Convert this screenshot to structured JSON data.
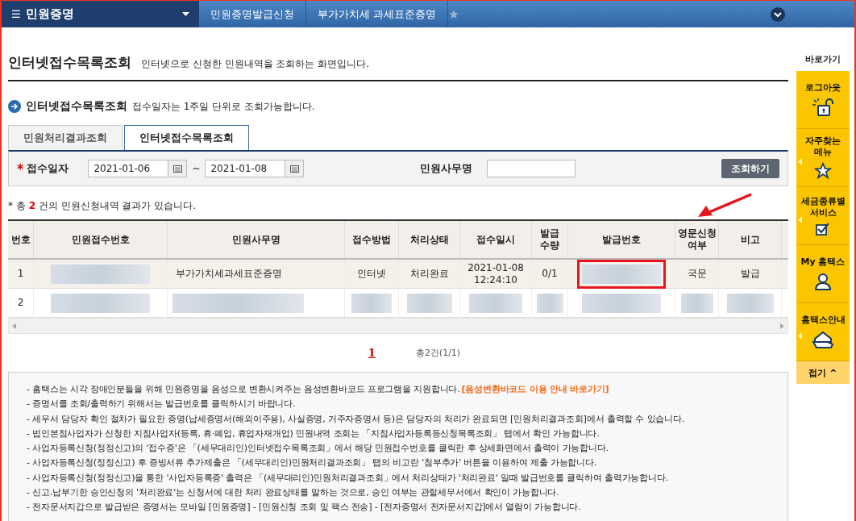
{
  "nav": {
    "menu_icon": "☰",
    "menu_title": "민원증명",
    "crumbs": [
      {
        "label": "민원증명발급신청"
      },
      {
        "label": "부가가치세 과세표준증명"
      }
    ]
  },
  "page": {
    "title": "인터넷접수목록조회",
    "subtitle": "인터넷으로 신청한 민원내역을 조회하는 화면입니다."
  },
  "section": {
    "title": "인터넷접수목록조회",
    "note": "접수일자는 1주일 단위로 조회가능합니다."
  },
  "tabs": [
    {
      "label": "민원처리결과조회",
      "selected": false
    },
    {
      "label": "인터넷접수목록조회",
      "selected": true
    }
  ],
  "search": {
    "required_mark": "*",
    "date_label": "접수일자",
    "date_from": "2021-01-06",
    "tilde": "~",
    "date_to": "2021-01-08",
    "name_label": "민원사무명",
    "button": "조회하기"
  },
  "result": {
    "prefix": "* 총",
    "count": "2",
    "suffix": "건의 민원신청내역 결과가 있습니다."
  },
  "table": {
    "columns": [
      "번호",
      "민원접수번호",
      "민원사무명",
      "접수방법",
      "처리상태",
      "접수일시",
      "발급\n수량",
      "발급번호",
      "영문신청\n여부",
      "비고"
    ],
    "rows": [
      {
        "selected": true,
        "cells": [
          {
            "kind": "text",
            "text": "1",
            "highlighted": false
          },
          {
            "kind": "redacted",
            "highlighted": false
          },
          {
            "kind": "text",
            "text": "부가가치세과세표준증명",
            "highlighted": false
          },
          {
            "kind": "text",
            "text": "인터넷",
            "highlighted": false
          },
          {
            "kind": "text",
            "text": "처리완료",
            "highlighted": false
          },
          {
            "kind": "text",
            "text": "2021-01-08\n12:24:10",
            "highlighted": false
          },
          {
            "kind": "text",
            "text": "0/1",
            "highlighted": false
          },
          {
            "kind": "redacted",
            "highlighted": true
          },
          {
            "kind": "text",
            "text": "국문",
            "highlighted": false
          },
          {
            "kind": "text",
            "text": "발급",
            "highlighted": false
          }
        ]
      },
      {
        "selected": false,
        "cells": [
          {
            "kind": "text",
            "text": "2",
            "highlighted": false
          },
          {
            "kind": "redacted",
            "highlighted": false
          },
          {
            "kind": "redacted",
            "highlighted": false
          },
          {
            "kind": "redacted",
            "highlighted": false
          },
          {
            "kind": "redacted",
            "highlighted": false
          },
          {
            "kind": "redacted",
            "highlighted": false
          },
          {
            "kind": "redacted",
            "highlighted": false
          },
          {
            "kind": "redacted",
            "highlighted": false
          },
          {
            "kind": "redacted",
            "highlighted": false
          },
          {
            "kind": "redacted",
            "highlighted": false
          }
        ]
      }
    ]
  },
  "pagination": {
    "pages": [
      {
        "label": "1",
        "selected": true
      }
    ],
    "total": "총2건(1/1)"
  },
  "notes": [
    {
      "text": "- 홈택스는 시각 장애인분들을 위해 민원증명을 음성으로 변환시켜주는 음성변환바코드 프로그램을 지원합니다.",
      "link": "[음성변환바코드 이용 안내 바로가기]"
    },
    {
      "text": "- 증명서를 조회/출력하기 위해서는 발급번호를 클릭하시기 바랍니다."
    },
    {
      "text": "- 세무서 담당자 확인 절차가 필요한 증명(납세증명서(해외이주용), 사실증명, 거주자증명서 등)은 담당자의 처리가 완료되면 [민원처리결과조회]에서 출력할 수 있습니다."
    },
    {
      "text": "- 법인본점사업자가 신청한 지점사업자(등록, 휴·폐업, 휴업자재개업) 민원내역 조회는 「지점사업자등록등신청목록조회」 탭에서 확인 가능합니다."
    },
    {
      "text": "- 사업자등록신청(정정신고)의 '접수증'은 「(세무대리인)인터넷접수목록조회」에서 해당 민원접수번호를 클릭한 후 상세화면에서 출력이 가능합니다."
    },
    {
      "text": "- 사업자등록신청(정정신고) 후 증빙서류 추가제출은 「(세무대리인)민원처리결과조회」 탭의 비고란 '첨부추가' 버튼을 이용하여 제출 가능합니다."
    },
    {
      "text": "- 사업자등록신청(정정신고)을 통한 '사업자등록증' 출력은 「(세무대리인)민원처리결과조회」에서 처리상태가 '처리완료' 일때 발급번호를 클릭하여 출력가능합니다."
    },
    {
      "text": "- 신고.납부기한 승인신청의 '처리완료'는 신청서에 대한 처리 완료상태를 말하는 것으로, 승인 여부는 관할세무서에서 확인이 가능합니다."
    },
    {
      "text": "- 전자문서지갑으로 발급받은 증명서는 모바일 [민원증명] - [민원신청 조회 및 팩스 전송] - [전자증명서 전자문서지갑]에서 열람이 가능합니다."
    }
  ],
  "quick": {
    "title": "바로가기",
    "items": [
      {
        "label": "로그아웃",
        "kind": "logout",
        "caret": false
      },
      {
        "label": "자주찾는\n메뉴",
        "kind": "favorites",
        "caret": true
      },
      {
        "label": "세금종류별\n서비스",
        "kind": "services",
        "caret": true
      },
      {
        "label": "My 홈택스",
        "kind": "mypage",
        "caret": false
      },
      {
        "label": "홈택스안내",
        "kind": "guide",
        "caret": true
      }
    ],
    "fold": "접기",
    "fold_caret": "^"
  },
  "annotations": [
    {
      "kind": "arrow"
    }
  ]
}
